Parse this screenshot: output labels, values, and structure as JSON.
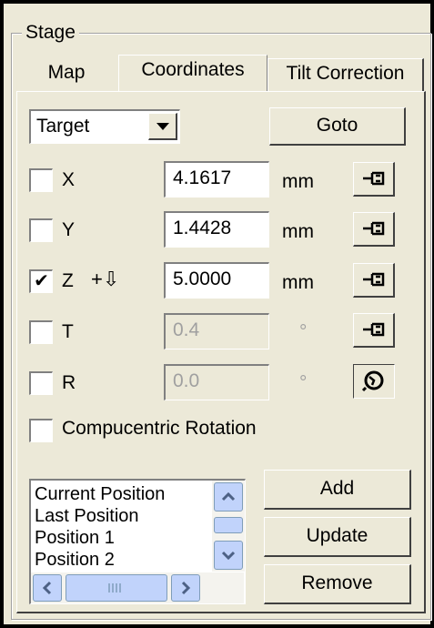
{
  "group": {
    "title": "Stage"
  },
  "tabs": [
    {
      "label": "Map",
      "active": false
    },
    {
      "label": "Coordinates",
      "active": true
    },
    {
      "label": "Tilt Correction",
      "active": false
    }
  ],
  "target_select": {
    "value": "Target"
  },
  "goto_button": {
    "label": "Goto"
  },
  "axes": [
    {
      "label": "X",
      "checked": false,
      "value": "4.1617",
      "unit": "mm",
      "enabled": true,
      "button_icon": "pin-icon"
    },
    {
      "label": "Y",
      "checked": false,
      "value": "1.4428",
      "unit": "mm",
      "enabled": true,
      "button_icon": "pin-icon"
    },
    {
      "label": "Z",
      "checked": true,
      "value": "5.0000",
      "unit": "mm",
      "enabled": true,
      "button_icon": "pin-icon",
      "extra": "+⇩"
    },
    {
      "label": "T",
      "checked": false,
      "value": "0.4",
      "unit": "°",
      "enabled": false,
      "button_icon": "pin-icon"
    },
    {
      "label": "R",
      "checked": false,
      "value": "0.0",
      "unit": "°",
      "enabled": false,
      "button_icon": "rotation-icon"
    }
  ],
  "compucentric": {
    "label": "Compucentric Rotation",
    "checked": false
  },
  "positions": {
    "items": [
      "Current Position",
      "Last Position",
      "Position 1",
      "Position 2"
    ]
  },
  "buttons": {
    "add": "Add",
    "update": "Update",
    "remove": "Remove"
  },
  "colors": {
    "face": "#ece9d8",
    "scroll_accent": "#c1d3fb",
    "scroll_arrow": "#4d6185"
  }
}
